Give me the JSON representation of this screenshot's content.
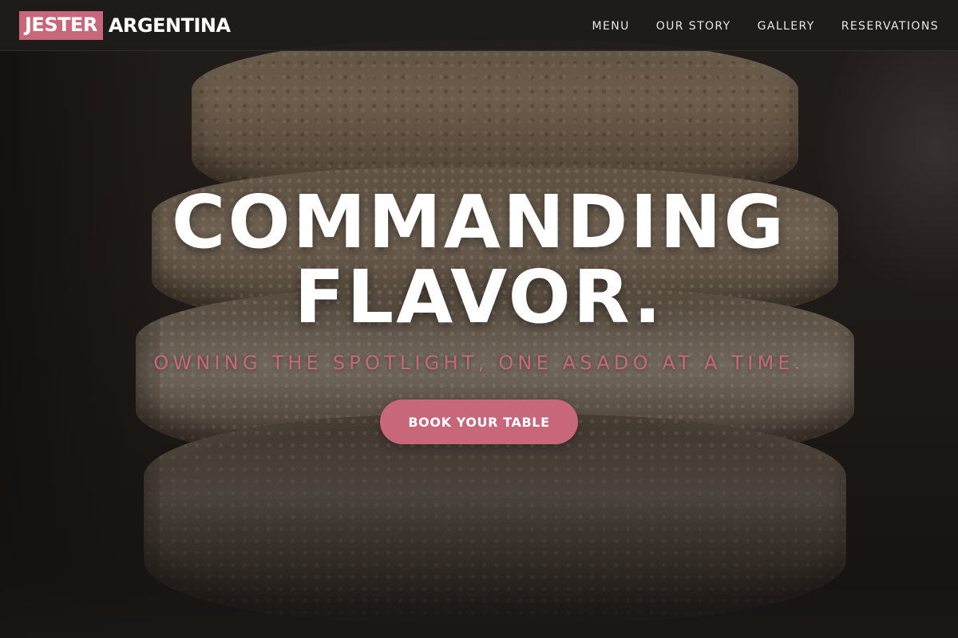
{
  "brand": {
    "highlight": "JESTER",
    "rest": "ARGENTINA",
    "accent_color": "#c8677a"
  },
  "nav": {
    "items": [
      {
        "label": "MENU"
      },
      {
        "label": "OUR STORY"
      },
      {
        "label": "GALLERY"
      },
      {
        "label": "RESERVATIONS"
      }
    ]
  },
  "hero": {
    "title_line1": "COMMANDING",
    "title_line2": "FLAVOR.",
    "tagline": "OWNING THE SPOTLIGHT, ONE ASADO AT A TIME.",
    "cta_label": "BOOK YOUR TABLE",
    "background_image": "stacked-bread-slices"
  }
}
